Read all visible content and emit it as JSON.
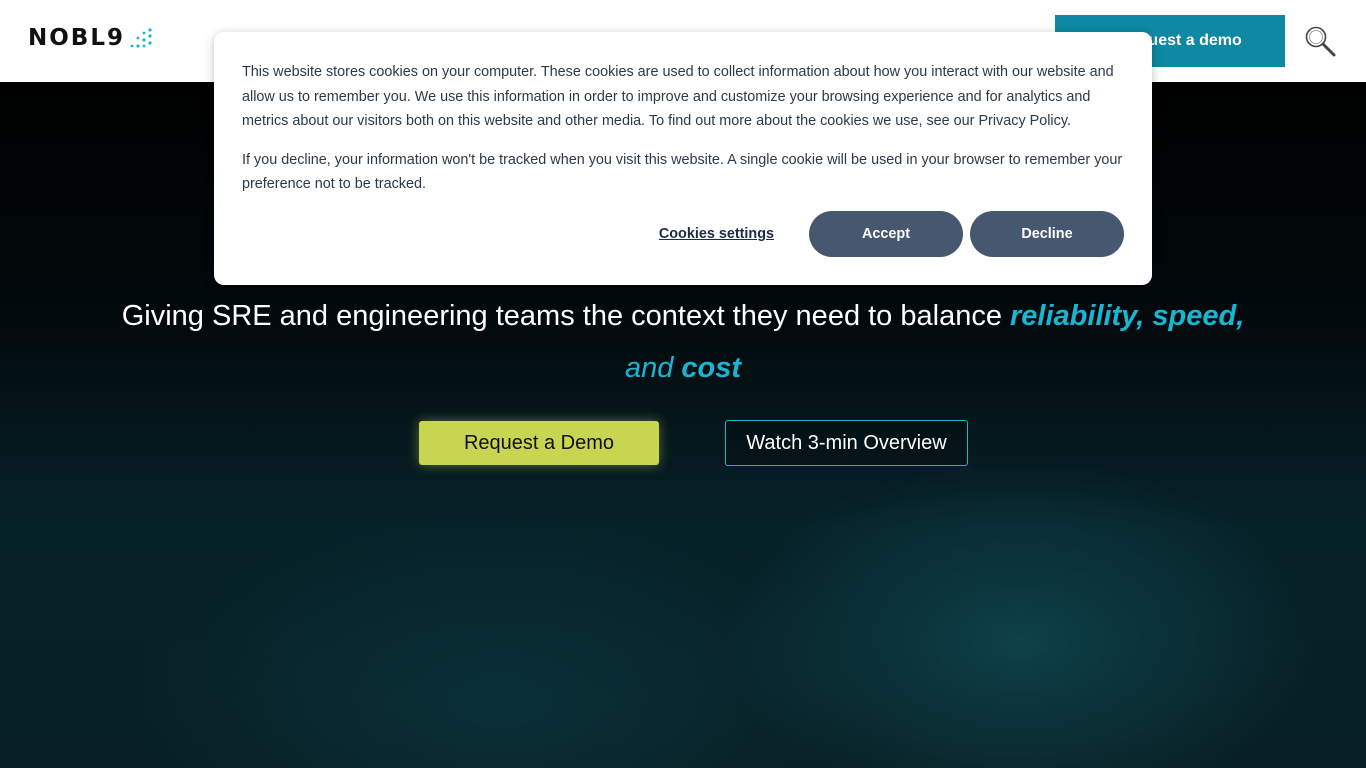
{
  "header": {
    "logo_text": "NOBL9",
    "cta_label": "Request a demo",
    "search_icon": "search-icon"
  },
  "cookie_banner": {
    "paragraph_1": "This website stores cookies on your computer. These cookies are used to collect information about how you interact with our website and allow us to remember you. We use this information in order to improve and customize your browsing experience and for analytics and metrics about our visitors both on this website and other media. To find out more about the cookies we use, see our Privacy Policy.",
    "paragraph_2": "If you decline, your information won't be tracked when you visit this website. A single cookie will be used in your browser to remember your preference not to be tracked.",
    "settings_label": "Cookies settings",
    "accept_label": "Accept",
    "decline_label": "Decline"
  },
  "hero": {
    "headline_main": "Giving SRE and engineering teams the context they need to balance ",
    "headline_accent_1": "reliability, speed,",
    "headline_and": "and ",
    "headline_accent_2": "cost",
    "demo_button": "Request a Demo",
    "overview_button": "Watch 3-min Overview"
  },
  "colors": {
    "accent_teal": "#19b5d3",
    "header_cta": "#0e88a3",
    "demo_button": "#c8d551",
    "cookie_button": "#45586f"
  }
}
